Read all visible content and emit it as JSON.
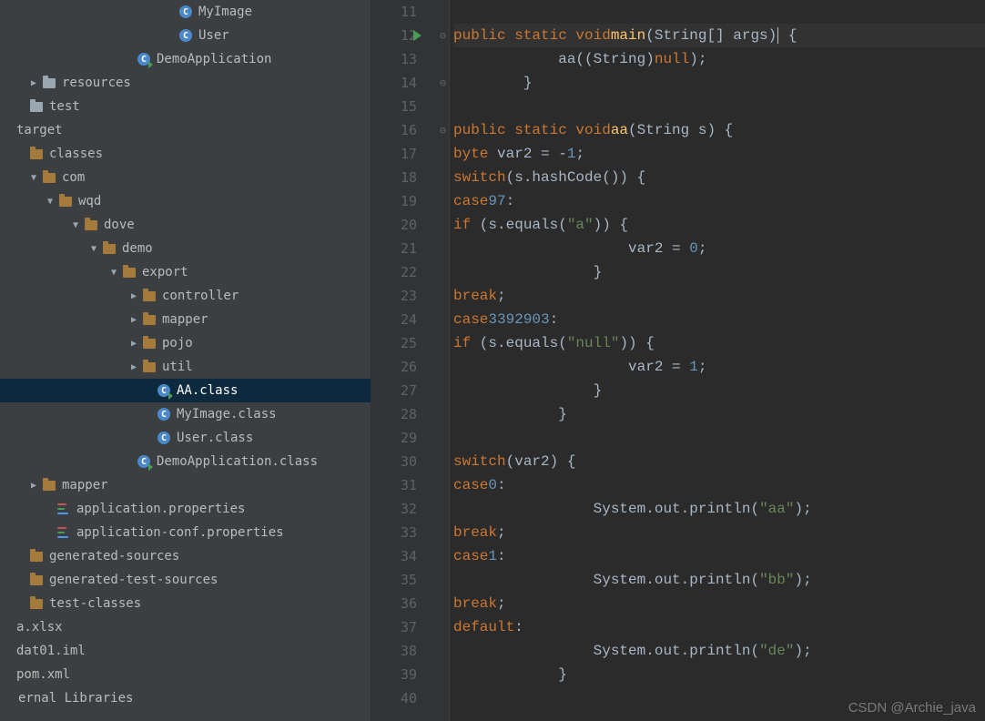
{
  "watermark": "CSDN @Archie_java",
  "tree": [
    {
      "indent": 150,
      "arrow": "",
      "icon": "class",
      "label": "MyImage"
    },
    {
      "indent": 150,
      "arrow": "",
      "icon": "class",
      "label": "User"
    },
    {
      "indent": 104,
      "arrow": "",
      "icon": "class-run",
      "label": "DemoApplication"
    },
    {
      "indent": 0,
      "arrow": "▶",
      "icon": "folder-plain",
      "label": "resources"
    },
    {
      "indent": -14,
      "arrow": "",
      "icon": "folder-plain",
      "label": "test"
    },
    {
      "indent": -28,
      "arrow": "",
      "icon": "",
      "label": "target"
    },
    {
      "indent": -14,
      "arrow": "",
      "icon": "folder-src",
      "label": "classes"
    },
    {
      "indent": 0,
      "arrow": "▼",
      "icon": "folder-src",
      "label": "com"
    },
    {
      "indent": 18,
      "arrow": "▼",
      "icon": "folder-src",
      "label": "wqd"
    },
    {
      "indent": 46,
      "arrow": "▼",
      "icon": "folder-src",
      "label": "dove"
    },
    {
      "indent": 66,
      "arrow": "▼",
      "icon": "folder-src",
      "label": "demo"
    },
    {
      "indent": 88,
      "arrow": "▼",
      "icon": "folder-src",
      "label": "export"
    },
    {
      "indent": 110,
      "arrow": "▶",
      "icon": "folder-src",
      "label": "controller"
    },
    {
      "indent": 110,
      "arrow": "▶",
      "icon": "folder-src",
      "label": "mapper"
    },
    {
      "indent": 110,
      "arrow": "▶",
      "icon": "folder-src",
      "label": "pojo"
    },
    {
      "indent": 110,
      "arrow": "▶",
      "icon": "folder-src",
      "label": "util"
    },
    {
      "indent": 126,
      "arrow": "",
      "icon": "class-run",
      "label": "AA.class",
      "selected": true
    },
    {
      "indent": 126,
      "arrow": "",
      "icon": "class",
      "label": "MyImage.class"
    },
    {
      "indent": 126,
      "arrow": "",
      "icon": "class",
      "label": "User.class"
    },
    {
      "indent": 104,
      "arrow": "",
      "icon": "class-run",
      "label": "DemoApplication.class"
    },
    {
      "indent": 0,
      "arrow": "▶",
      "icon": "folder-src",
      "label": "mapper"
    },
    {
      "indent": 16,
      "arrow": "",
      "icon": "props",
      "label": "application.properties"
    },
    {
      "indent": 16,
      "arrow": "",
      "icon": "props",
      "label": "application-conf.properties"
    },
    {
      "indent": -14,
      "arrow": "",
      "icon": "folder-src",
      "label": "generated-sources"
    },
    {
      "indent": -14,
      "arrow": "",
      "icon": "folder-src",
      "label": "generated-test-sources"
    },
    {
      "indent": -14,
      "arrow": "",
      "icon": "folder-src",
      "label": "test-classes"
    },
    {
      "indent": -28,
      "arrow": "",
      "icon": "",
      "label": "a.xlsx"
    },
    {
      "indent": -28,
      "arrow": "",
      "icon": "",
      "label": "dat01.iml"
    },
    {
      "indent": -28,
      "arrow": "",
      "icon": "",
      "label": "pom.xml"
    },
    {
      "indent": -42,
      "arrow": "",
      "icon": "",
      "label": "ernal Libraries"
    }
  ],
  "gutter_start": 11,
  "gutter_end": 40,
  "run_line": 12,
  "fold_lines": [
    12,
    14,
    16
  ],
  "code_lines": [
    {
      "n": 11,
      "html": ""
    },
    {
      "n": 12,
      "hl": true,
      "html": "    <span class='kw'>public static void</span> <span class='fn'>main</span>(String[] args)<span class='caret'></span> {"
    },
    {
      "n": 13,
      "html": "        aa((String)<span class='kw'>null</span>);"
    },
    {
      "n": 14,
      "html": "    }"
    },
    {
      "n": 15,
      "html": ""
    },
    {
      "n": 16,
      "html": "    <span class='kw'>public static void</span> <span class='fn'>aa</span>(String s) {"
    },
    {
      "n": 17,
      "html": "        <span class='kw'>byte</span> var2 = -<span class='num'>1</span>;"
    },
    {
      "n": 18,
      "html": "        <span class='kw'>switch</span>(s.hashCode()) {"
    },
    {
      "n": 19,
      "html": "        <span class='kw'>case</span> <span class='num'>97</span>:"
    },
    {
      "n": 20,
      "html": "            <span class='kw'>if</span> (s.equals(<span class='str'>\"a\"</span>)) {"
    },
    {
      "n": 21,
      "html": "                var2 = <span class='num'>0</span>;"
    },
    {
      "n": 22,
      "html": "            }"
    },
    {
      "n": 23,
      "html": "            <span class='kw'>break</span>;"
    },
    {
      "n": 24,
      "html": "        <span class='kw'>case</span> <span class='num'>3392903</span>:"
    },
    {
      "n": 25,
      "html": "            <span class='kw'>if</span> (s.equals(<span class='str'>\"null\"</span>)) {"
    },
    {
      "n": 26,
      "html": "                var2 = <span class='num'>1</span>;"
    },
    {
      "n": 27,
      "html": "            }"
    },
    {
      "n": 28,
      "html": "        }"
    },
    {
      "n": 29,
      "html": ""
    },
    {
      "n": 30,
      "html": "        <span class='kw'>switch</span>(var2) {"
    },
    {
      "n": 31,
      "html": "        <span class='kw'>case</span> <span class='num'>0</span>:"
    },
    {
      "n": 32,
      "html": "            System.out.println(<span class='str'>\"aa\"</span>);"
    },
    {
      "n": 33,
      "html": "            <span class='kw'>break</span>;"
    },
    {
      "n": 34,
      "html": "        <span class='kw'>case</span> <span class='num'>1</span>:"
    },
    {
      "n": 35,
      "html": "            System.out.println(<span class='str'>\"bb\"</span>);"
    },
    {
      "n": 36,
      "html": "            <span class='kw'>break</span>;"
    },
    {
      "n": 37,
      "html": "        <span class='kw'>default</span>:"
    },
    {
      "n": 38,
      "html": "            System.out.println(<span class='str'>\"de\"</span>);"
    },
    {
      "n": 39,
      "html": "        }"
    },
    {
      "n": 40,
      "html": ""
    }
  ]
}
